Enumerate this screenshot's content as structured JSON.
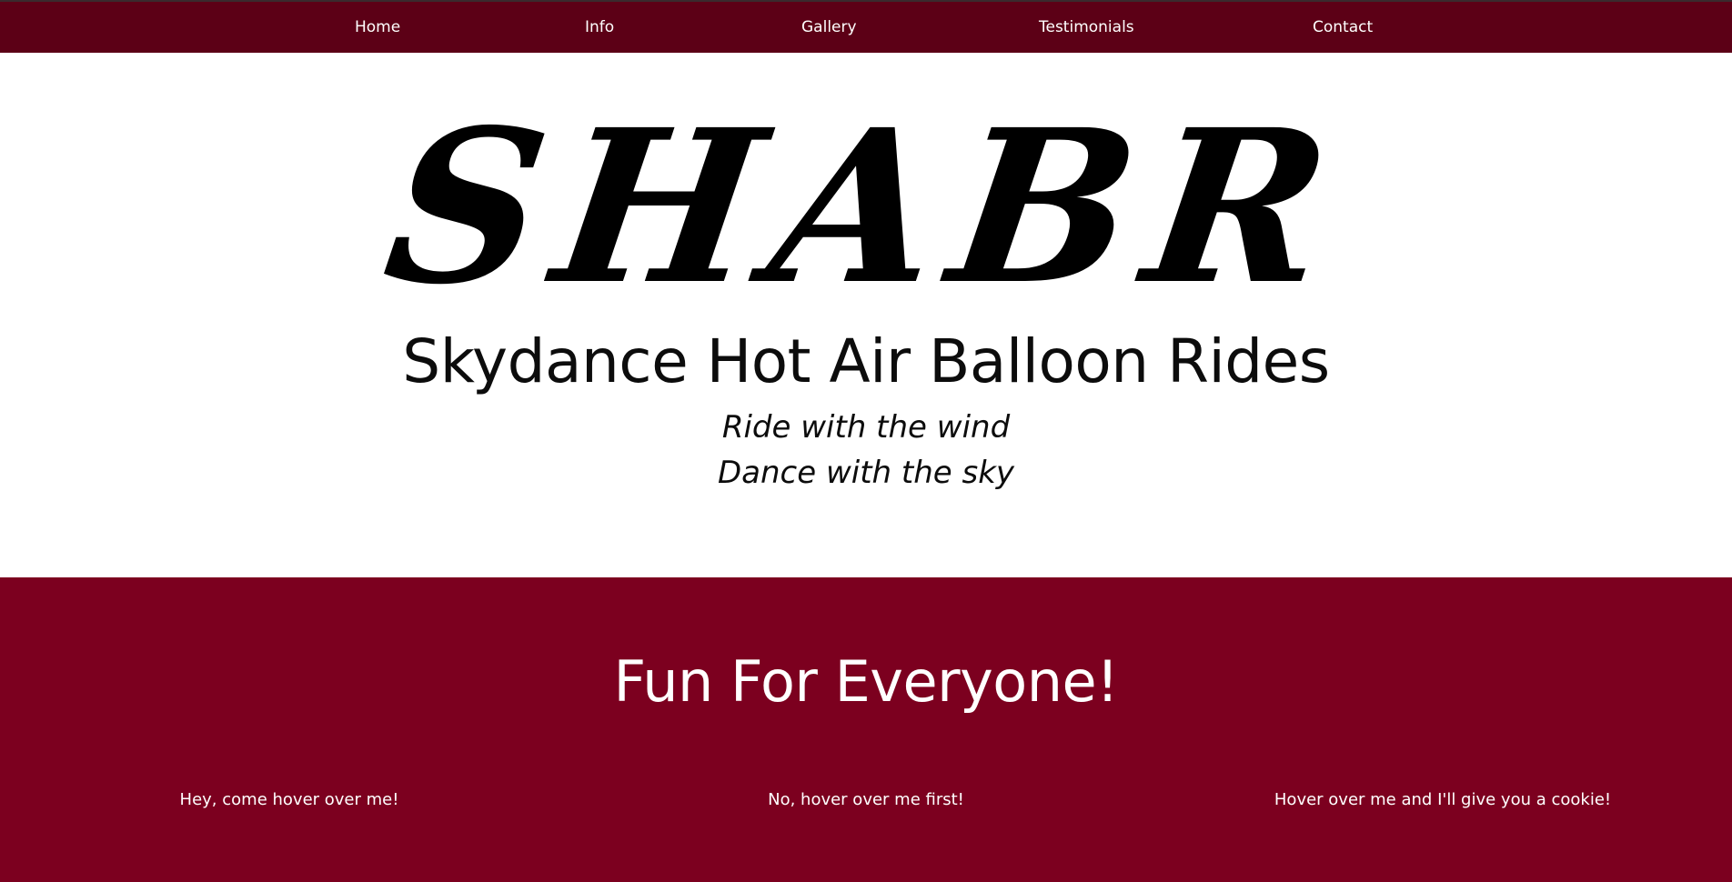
{
  "nav": {
    "items": [
      {
        "label": "Home"
      },
      {
        "label": "Info"
      },
      {
        "label": "Gallery"
      },
      {
        "label": "Testimonials"
      },
      {
        "label": "Contact"
      }
    ]
  },
  "hero": {
    "logo_text": "SHABR",
    "title": "Skydance Hot Air Balloon Rides",
    "tagline_line1": "Ride with the wind",
    "tagline_line2": "Dance with the sky"
  },
  "fun_section": {
    "heading": "Fun For Everyone!",
    "hover_items": [
      {
        "label": "Hey, come hover over me!"
      },
      {
        "label": "No, hover over me first!"
      },
      {
        "label": "Hover over me and I'll give you a cookie!"
      }
    ]
  },
  "colors": {
    "nav_background": "#5c0016",
    "section_background": "#7c001f",
    "text_light": "#ffffff",
    "text_dark": "#000000"
  }
}
